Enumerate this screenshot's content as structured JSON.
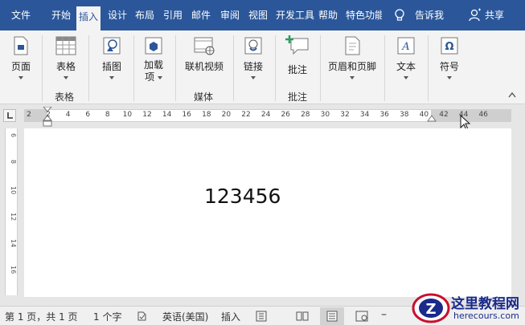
{
  "tabs": [
    {
      "label": "文件"
    },
    {
      "label": "开始"
    },
    {
      "label": "插入"
    },
    {
      "label": "设计"
    },
    {
      "label": "布局"
    },
    {
      "label": "引用"
    },
    {
      "label": "邮件"
    },
    {
      "label": "审阅"
    },
    {
      "label": "视图"
    },
    {
      "label": "开发工具"
    },
    {
      "label": "帮助"
    },
    {
      "label": "特色功能"
    }
  ],
  "tell_me": "告诉我",
  "share": "共享",
  "ribbon": {
    "page": "页面",
    "table": "表格",
    "illustrations": "插图",
    "addins": "加载\n项",
    "online_video": "联机视频",
    "link": "链接",
    "comment": "批注",
    "header_footer": "页眉和页脚",
    "text": "文本",
    "symbols": "符号",
    "groups": {
      "table": "表格",
      "media": "媒体",
      "comments": "批注"
    }
  },
  "ruler_numbers": [
    "2",
    "2",
    "4",
    "6",
    "8",
    "10",
    "12",
    "14",
    "16",
    "18",
    "20",
    "22",
    "24",
    "26",
    "28",
    "30",
    "32",
    "34",
    "36",
    "38",
    "40",
    "42",
    "44",
    "46"
  ],
  "vruler_numbers": [
    "6",
    "8",
    "10",
    "12",
    "14",
    "16"
  ],
  "document": {
    "text": "123456"
  },
  "status": {
    "page": "第 1 页，共 1 页",
    "words": "1 个字",
    "language": "英语(美国)",
    "mode": "插入"
  },
  "watermark": {
    "title": "这里教程网",
    "url": "herecours.com"
  },
  "colors": {
    "accent": "#2b579a",
    "ribbon_bg": "#f3f3f3"
  }
}
